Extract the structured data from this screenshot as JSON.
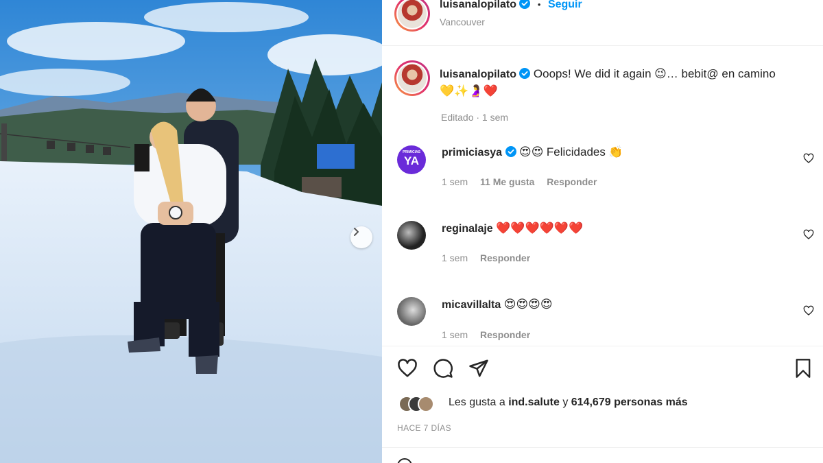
{
  "post": {
    "username": "luisanalopilato",
    "follow_label": "Seguir",
    "separator": "•",
    "location": "Vancouver",
    "caption": "Ooops! We did it again",
    "caption_emoji_1": "😉",
    "caption_part2": "… bebit@ en camino",
    "caption_emoji_2": "💛✨🤰❤️",
    "edited": "Editado · 1 sem"
  },
  "comments": [
    {
      "user": "primiciasya",
      "verified": true,
      "emoji": "😍😍",
      "text": "Felicidades",
      "emoji_after": "👏",
      "time": "1 sem",
      "likes": "11 Me gusta",
      "reply_label": "Responder",
      "avatar_text": "YA",
      "avatar_small": "PRIMICIAS"
    },
    {
      "user": "reginalaje",
      "verified": false,
      "emoji": "❤️❤️❤️❤️❤️❤️",
      "time": "1 sem",
      "reply_label": "Responder"
    },
    {
      "user": "micavillalta",
      "verified": false,
      "emoji": "😍😍😍😍",
      "time": "1 sem",
      "reply_label": "Responder"
    }
  ],
  "likes": {
    "prefix": "Les gusta a",
    "user": "ind.salute",
    "connector": "y",
    "count": "614,679 personas más"
  },
  "timestamp": "HACE 7 DÍAS",
  "icons": [
    "verified-badge-icon",
    "heart-icon",
    "comment-icon",
    "share-icon",
    "bookmark-icon",
    "chevron-right-icon"
  ],
  "colors": {
    "accent": "#0095f6",
    "muted": "#8e8e8e",
    "primicias_purple": "#6a2bd9"
  }
}
